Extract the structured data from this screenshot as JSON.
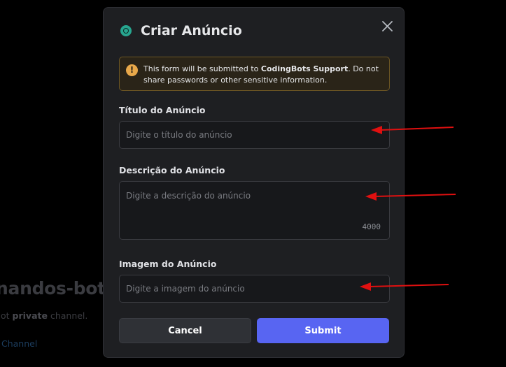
{
  "background": {
    "heading": "nandos-bot!",
    "description_prefix": "ot ",
    "description_bold": "private",
    "description_suffix": " channel.",
    "link": "Channel"
  },
  "modal": {
    "title": "Criar Anúncio",
    "app_icon": "bot-avatar-icon",
    "close_icon": "close-icon",
    "warning": {
      "icon": "exclamation-icon",
      "text_prefix": "This form will be submitted to ",
      "app_name": "CodingBots Support",
      "text_suffix": ". Do not share passwords or other sensitive information."
    },
    "fields": {
      "title": {
        "label": "Título do Anúncio",
        "placeholder": "Digite o título do anúncio",
        "value": ""
      },
      "description": {
        "label": "Descrição do Anúncio",
        "placeholder": "Digite a descrição do anúncio",
        "value": "",
        "char_limit": "4000"
      },
      "image": {
        "label": "Imagem do Anúncio",
        "placeholder": "Digite a imagem do anúncio",
        "value": ""
      }
    },
    "buttons": {
      "cancel": "Cancel",
      "submit": "Submit"
    }
  },
  "colors": {
    "accent": "#5865f2",
    "annotation_arrow": "#e01010",
    "warning_icon": "#e8a84a"
  }
}
